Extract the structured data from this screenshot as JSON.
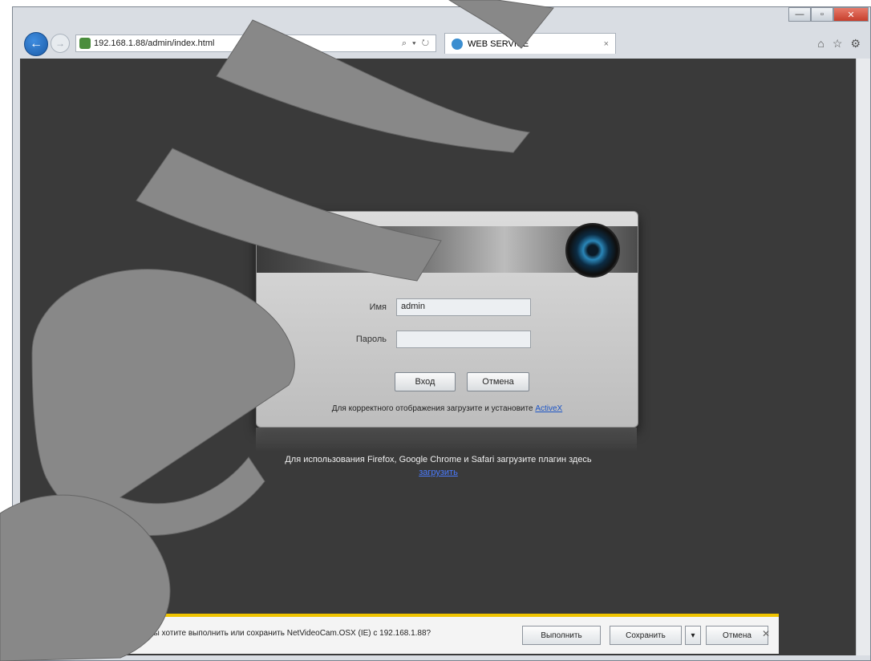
{
  "browser": {
    "address": "192.168.1.88/admin/index.html",
    "tab_title": "WEB SERVICE",
    "icons": [
      "back-arrow-icon",
      "forward-arrow-icon",
      "search-icon",
      "refresh-icon",
      "home-icon",
      "star-icon",
      "gear-icon",
      "minimize-icon",
      "maximize-icon",
      "close-icon"
    ]
  },
  "login": {
    "user_label": "Имя",
    "user_value": "admin",
    "password_label": "Пароль",
    "password_value": "",
    "login_button": "Вход",
    "cancel_button": "Отмена",
    "note_text": "Для корректного отображения загрузите и установите",
    "note_link": "ActiveX"
  },
  "page_warning": {
    "text": "Для использования Firefox, Google Chrome и Safari загрузите плагин здесь",
    "link": "загрузить"
  },
  "download_bar": {
    "message": "Вы хотите выполнить или сохранить NetVideoCam.OSX (IE) с 192.168.1.88?",
    "run_button": "Выполнить",
    "save_button": "Сохранить",
    "dropdown_arrow": "▾",
    "cancel_button": "Отмена"
  },
  "colors": {
    "viewport_bg": "#3a3a3a",
    "accent_bar": "#f0c400",
    "watermark": "#888888"
  }
}
